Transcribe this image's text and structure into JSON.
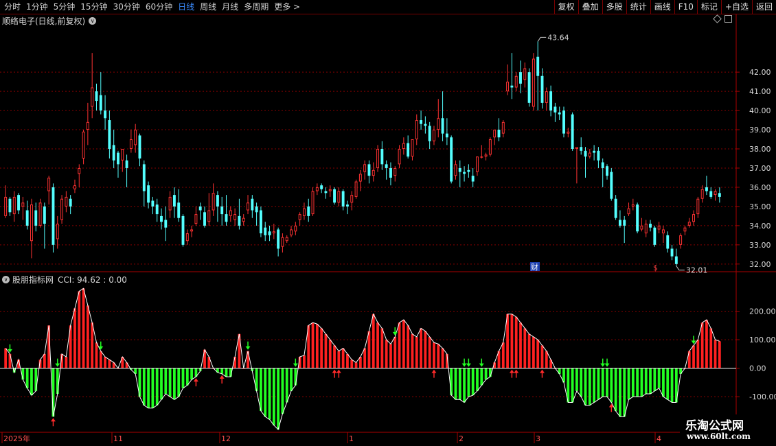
{
  "toolbar": {
    "periods": [
      "分时",
      "1分钟",
      "5分钟",
      "15分钟",
      "30分钟",
      "60分钟",
      "日线",
      "周线",
      "月线",
      "多周期",
      "更多 >"
    ],
    "active_period": "日线",
    "right_buttons": [
      "复权",
      "叠加",
      "多股",
      "统计",
      "画线",
      "F10",
      "标记",
      "+自选",
      "返回"
    ]
  },
  "stock": {
    "title": "顺络电子(日线,前复权)"
  },
  "indicator": {
    "name": "股朋指标网",
    "readout": "CCI: 94.62 : 0.00"
  },
  "colors": {
    "up": "#ff3232",
    "down": "#54ffff",
    "cci_pos": "#ff2020",
    "cci_neg": "#22ff22",
    "grid": "#8a0000",
    "axis": "#aa0000",
    "label": "#d8d8d8"
  },
  "chart_data": [
    {
      "type": "candlestick",
      "title": "顺络电子(日线,前复权)",
      "y_ticks": [
        32.0,
        33.0,
        34.0,
        35.0,
        36.0,
        37.0,
        38.0,
        39.0,
        40.0,
        41.0,
        42.0
      ],
      "ylim": [
        31.6,
        44.4
      ],
      "annotations": {
        "high": "43.64",
        "low": "32.01",
        "markers": [
          "财",
          "$"
        ]
      },
      "candles": [
        [
          34.5,
          36.1,
          35.5,
          34.4
        ],
        [
          35.4,
          35.5,
          34.7,
          34.5
        ],
        [
          34.6,
          35.8,
          35.5,
          34.2
        ],
        [
          35.6,
          35.7,
          34.8,
          34.6
        ],
        [
          35.0,
          35.5,
          35.2,
          34.3
        ],
        [
          34.8,
          35.3,
          34.0,
          33.8
        ],
        [
          33.2,
          35.4,
          35.1,
          32.3
        ],
        [
          34.8,
          35.2,
          34.0,
          33.7
        ],
        [
          34.0,
          35.4,
          35.2,
          33.9
        ],
        [
          35.0,
          35.2,
          34.1,
          32.8
        ],
        [
          35.8,
          36.6,
          36.5,
          35.1
        ],
        [
          36.0,
          36.2,
          33.0,
          32.6
        ],
        [
          33.3,
          34.5,
          34.1,
          32.8
        ],
        [
          34.3,
          35.6,
          35.4,
          34.1
        ],
        [
          35.0,
          35.8,
          35.5,
          34.7
        ],
        [
          35.4,
          35.6,
          35.0,
          34.6
        ],
        [
          35.9,
          36.4,
          36.1,
          35.7
        ],
        [
          36.7,
          37.2,
          37.0,
          36.0
        ],
        [
          37.5,
          39.0,
          38.9,
          37.2
        ],
        [
          39.0,
          40.4,
          39.4,
          38.2
        ],
        [
          40.2,
          43.0,
          41.2,
          39.6
        ],
        [
          41.0,
          41.4,
          40.5,
          40.0
        ],
        [
          40.8,
          42.0,
          40.0,
          39.8
        ],
        [
          40.0,
          40.8,
          39.6,
          39.0
        ],
        [
          39.5,
          40.0,
          38.0,
          37.5
        ],
        [
          38.2,
          39.0,
          37.4,
          37.0
        ],
        [
          37.8,
          37.9,
          37.2,
          36.5
        ],
        [
          37.4,
          37.8,
          38.0,
          36.8
        ],
        [
          37.4,
          37.7,
          37.0,
          36.0
        ],
        [
          38.0,
          39.0,
          38.5,
          37.8
        ],
        [
          38.2,
          39.3,
          39.0,
          37.8
        ],
        [
          38.7,
          38.8,
          37.5,
          37.1
        ],
        [
          37.2,
          37.4,
          35.8,
          35.0
        ],
        [
          36.1,
          36.3,
          35.2,
          34.9
        ],
        [
          35.3,
          35.5,
          35.0,
          34.6
        ],
        [
          35.1,
          35.4,
          34.6,
          34.2
        ],
        [
          34.5,
          34.9,
          34.2,
          33.8
        ],
        [
          34.3,
          35.0,
          33.9,
          33.2
        ],
        [
          34.8,
          35.8,
          35.5,
          34.4
        ],
        [
          35.6,
          36.0,
          35.0,
          34.4
        ],
        [
          35.2,
          35.9,
          34.4,
          34.2
        ],
        [
          34.5,
          34.6,
          33.0,
          32.9
        ],
        [
          33.2,
          33.8,
          33.6,
          33.0
        ],
        [
          33.7,
          34.0,
          33.8,
          33.4
        ],
        [
          34.1,
          35.0,
          34.6,
          34.0
        ],
        [
          35.0,
          35.2,
          34.8,
          34.3
        ],
        [
          34.7,
          35.0,
          34.0,
          33.9
        ],
        [
          34.2,
          35.7,
          34.8,
          34.0
        ],
        [
          34.8,
          36.2,
          35.7,
          34.5
        ],
        [
          35.6,
          35.8,
          35.0,
          34.2
        ],
        [
          35.0,
          35.5,
          34.6,
          34.0
        ],
        [
          34.6,
          35.6,
          34.2,
          34.0
        ],
        [
          34.5,
          35.0,
          34.8,
          34.2
        ],
        [
          34.3,
          34.9,
          34.6,
          34.0
        ],
        [
          34.5,
          35.4,
          34.0,
          33.8
        ],
        [
          34.2,
          34.6,
          34.4,
          34.0
        ],
        [
          34.8,
          35.6,
          35.2,
          34.6
        ],
        [
          35.4,
          35.6,
          34.8,
          34.4
        ],
        [
          35.0,
          35.2,
          34.7,
          34.0
        ],
        [
          34.8,
          35.0,
          33.6,
          33.4
        ],
        [
          33.9,
          34.2,
          33.5,
          33.2
        ],
        [
          33.7,
          34.0,
          33.5,
          33.2
        ],
        [
          33.6,
          34.1,
          33.7,
          33.3
        ],
        [
          33.8,
          33.9,
          32.8,
          32.4
        ],
        [
          32.9,
          33.6,
          33.4,
          32.6
        ],
        [
          33.2,
          33.5,
          33.4,
          33.1
        ],
        [
          33.5,
          34.0,
          33.8,
          33.4
        ],
        [
          33.7,
          34.2,
          34.0,
          33.5
        ],
        [
          34.3,
          34.7,
          34.6,
          34.0
        ],
        [
          34.5,
          35.2,
          34.9,
          34.3
        ],
        [
          35.0,
          35.4,
          34.5,
          34.2
        ],
        [
          34.6,
          36.0,
          35.8,
          34.5
        ],
        [
          35.8,
          36.2,
          36.0,
          35.6
        ],
        [
          36.1,
          36.2,
          35.9,
          35.7
        ],
        [
          35.8,
          36.0,
          35.7,
          35.4
        ],
        [
          35.8,
          36.1,
          35.9,
          35.5
        ],
        [
          35.9,
          36.0,
          35.2,
          35.1
        ],
        [
          35.2,
          36.0,
          35.8,
          35.0
        ],
        [
          35.8,
          35.9,
          35.0,
          34.8
        ],
        [
          35.1,
          35.3,
          35.0,
          34.6
        ],
        [
          35.2,
          35.8,
          35.6,
          34.8
        ],
        [
          35.5,
          36.4,
          36.3,
          35.4
        ],
        [
          36.3,
          36.9,
          36.7,
          35.8
        ],
        [
          36.8,
          37.4,
          37.2,
          36.4
        ],
        [
          37.2,
          37.4,
          36.6,
          36.2
        ],
        [
          36.6,
          37.3,
          36.9,
          36.3
        ],
        [
          37.0,
          38.2,
          38.0,
          36.8
        ],
        [
          38.0,
          38.4,
          37.2,
          36.9
        ],
        [
          37.2,
          37.4,
          37.0,
          36.4
        ],
        [
          37.0,
          37.3,
          36.5,
          36.1
        ],
        [
          36.6,
          37.1,
          37.0,
          36.3
        ],
        [
          37.2,
          38.2,
          38.0,
          37.0
        ],
        [
          38.0,
          38.6,
          38.3,
          37.7
        ],
        [
          38.3,
          38.7,
          37.6,
          37.5
        ],
        [
          37.6,
          38.4,
          38.5,
          37.4
        ],
        [
          38.5,
          39.8,
          39.5,
          38.2
        ],
        [
          39.5,
          40.0,
          39.3,
          39.0
        ],
        [
          39.3,
          39.7,
          39.2,
          38.8
        ],
        [
          39.2,
          39.4,
          38.4,
          38.0
        ],
        [
          38.4,
          39.2,
          39.0,
          38.2
        ],
        [
          39.0,
          40.6,
          39.6,
          38.6
        ],
        [
          39.6,
          41.0,
          38.8,
          38.4
        ],
        [
          38.8,
          39.6,
          38.6,
          38.2
        ],
        [
          38.6,
          38.7,
          36.3,
          36.2
        ],
        [
          36.6,
          37.4,
          37.2,
          36.4
        ],
        [
          37.0,
          37.4,
          36.8,
          36.0
        ],
        [
          36.8,
          37.1,
          36.7,
          36.3
        ],
        [
          36.9,
          37.2,
          36.8,
          36.5
        ],
        [
          36.6,
          37.0,
          36.3,
          36.0
        ],
        [
          36.8,
          37.6,
          37.6,
          36.6
        ],
        [
          37.6,
          38.2,
          37.6,
          37.5
        ],
        [
          37.6,
          37.8,
          37.7,
          37.4
        ],
        [
          37.7,
          38.6,
          38.5,
          37.6
        ],
        [
          38.6,
          39.0,
          39.0,
          38.2
        ],
        [
          39.0,
          39.6,
          38.6,
          38.4
        ],
        [
          38.8,
          39.5,
          39.4,
          38.6
        ],
        [
          41.0,
          42.4,
          41.5,
          40.8
        ],
        [
          41.3,
          43.0,
          41.2,
          40.6
        ],
        [
          41.2,
          42.0,
          41.8,
          41.0
        ],
        [
          42.0,
          42.6,
          41.4,
          40.9
        ],
        [
          41.6,
          42.5,
          42.2,
          41.2
        ],
        [
          42.0,
          42.2,
          40.4,
          40.2
        ],
        [
          40.2,
          43.0,
          42.7,
          40.0
        ],
        [
          42.8,
          43.6,
          41.8,
          40.0
        ],
        [
          41.8,
          42.2,
          40.4,
          40.1
        ],
        [
          40.4,
          41.2,
          41.0,
          40.0
        ],
        [
          41.0,
          41.3,
          40.0,
          39.7
        ],
        [
          40.2,
          40.4,
          39.9,
          39.4
        ],
        [
          39.9,
          40.2,
          39.8,
          39.5
        ],
        [
          40.0,
          40.2,
          38.8,
          38.6
        ],
        [
          38.8,
          39.1,
          38.9,
          38.6
        ],
        [
          39.8,
          39.9,
          38.0,
          37.9
        ],
        [
          38.0,
          38.1,
          38.1,
          36.2
        ],
        [
          38.1,
          38.6,
          37.9,
          37.7
        ],
        [
          37.9,
          38.1,
          37.6,
          36.5
        ],
        [
          37.6,
          38.0,
          37.8,
          37.5
        ],
        [
          37.9,
          38.2,
          37.8,
          37.4
        ],
        [
          37.9,
          38.1,
          37.4,
          37.0
        ],
        [
          37.3,
          37.5,
          37.0,
          36.0
        ],
        [
          37.1,
          37.2,
          36.6,
          36.4
        ],
        [
          36.8,
          37.0,
          35.4,
          35.3
        ],
        [
          35.4,
          35.6,
          34.4,
          34.3
        ],
        [
          34.3,
          34.8,
          34.0,
          33.9
        ],
        [
          34.3,
          34.5,
          34.0,
          33.1
        ],
        [
          34.6,
          35.2,
          34.9,
          34.5
        ],
        [
          35.0,
          35.4,
          35.1,
          34.8
        ],
        [
          35.1,
          35.2,
          33.7,
          33.6
        ],
        [
          33.8,
          34.4,
          34.0,
          33.7
        ],
        [
          33.6,
          34.3,
          34.1,
          33.4
        ],
        [
          34.1,
          34.3,
          33.9,
          33.7
        ],
        [
          33.9,
          34.0,
          33.0,
          32.9
        ],
        [
          33.8,
          34.2,
          34.0,
          33.6
        ],
        [
          33.6,
          34.0,
          33.8,
          33.1
        ],
        [
          33.5,
          33.7,
          32.8,
          32.6
        ],
        [
          32.8,
          33.0,
          32.4,
          32.2
        ],
        [
          32.4,
          32.8,
          32.0,
          31.9
        ],
        [
          33.0,
          33.6,
          33.5,
          32.8
        ],
        [
          33.7,
          34.0,
          33.9,
          33.5
        ],
        [
          34.0,
          34.4,
          34.2,
          33.9
        ],
        [
          34.2,
          34.8,
          34.6,
          34.0
        ],
        [
          34.6,
          35.5,
          35.4,
          34.4
        ],
        [
          35.4,
          36.1,
          35.9,
          35.2
        ],
        [
          36.0,
          36.6,
          35.8,
          35.6
        ],
        [
          35.8,
          36.0,
          35.5,
          35.4
        ],
        [
          35.6,
          35.9,
          35.8,
          35.3
        ],
        [
          35.7,
          36.0,
          35.5,
          35.2
        ]
      ]
    },
    {
      "type": "bar",
      "title": "CCI",
      "y_ticks": [
        -100.0,
        0.0,
        100.0,
        200.0
      ],
      "ylim": [
        -220,
        300
      ],
      "x_labels": [
        "2025年",
        "11",
        "12",
        "1",
        "2",
        "3",
        "4"
      ],
      "values": [
        70,
        50,
        -15,
        30,
        -40,
        -70,
        -95,
        -80,
        30,
        50,
        150,
        -170,
        -90,
        50,
        40,
        150,
        210,
        270,
        280,
        220,
        160,
        90,
        60,
        40,
        30,
        20,
        0,
        40,
        20,
        -5,
        -20,
        -100,
        -130,
        -140,
        -140,
        -130,
        -110,
        -90,
        -100,
        -110,
        -100,
        -70,
        -60,
        -40,
        -30,
        -10,
        65,
        40,
        0,
        -15,
        -20,
        -30,
        -30,
        40,
        120,
        0,
        60,
        -10,
        -80,
        -150,
        -170,
        -180,
        -200,
        -215,
        -160,
        -120,
        -80,
        -60,
        40,
        45,
        150,
        160,
        155,
        140,
        120,
        100,
        80,
        60,
        70,
        50,
        30,
        20,
        40,
        70,
        130,
        190,
        160,
        140,
        100,
        85,
        110,
        160,
        170,
        150,
        120,
        110,
        140,
        130,
        110,
        90,
        85,
        70,
        50,
        -95,
        -110,
        -110,
        -120,
        -100,
        -95,
        -80,
        -60,
        -40,
        -30,
        20,
        60,
        90,
        190,
        190,
        180,
        160,
        140,
        120,
        110,
        100,
        80,
        60,
        30,
        0,
        -20,
        -50,
        -120,
        -120,
        -80,
        -100,
        -130,
        -130,
        -120,
        -110,
        -100,
        -100,
        -120,
        -150,
        -170,
        -170,
        -110,
        -100,
        -100,
        -100,
        -90,
        -90,
        -80,
        -70,
        -100,
        -110,
        -120,
        -120,
        -20,
        0,
        60,
        80,
        100,
        160,
        170,
        140,
        100,
        94.62
      ],
      "up_signals": [
        11,
        44,
        50,
        76,
        77,
        99,
        117,
        118,
        124,
        140
      ],
      "down_signals": [
        1,
        12,
        22,
        56,
        67,
        90,
        106,
        107,
        110,
        138,
        139,
        159
      ]
    }
  ]
}
